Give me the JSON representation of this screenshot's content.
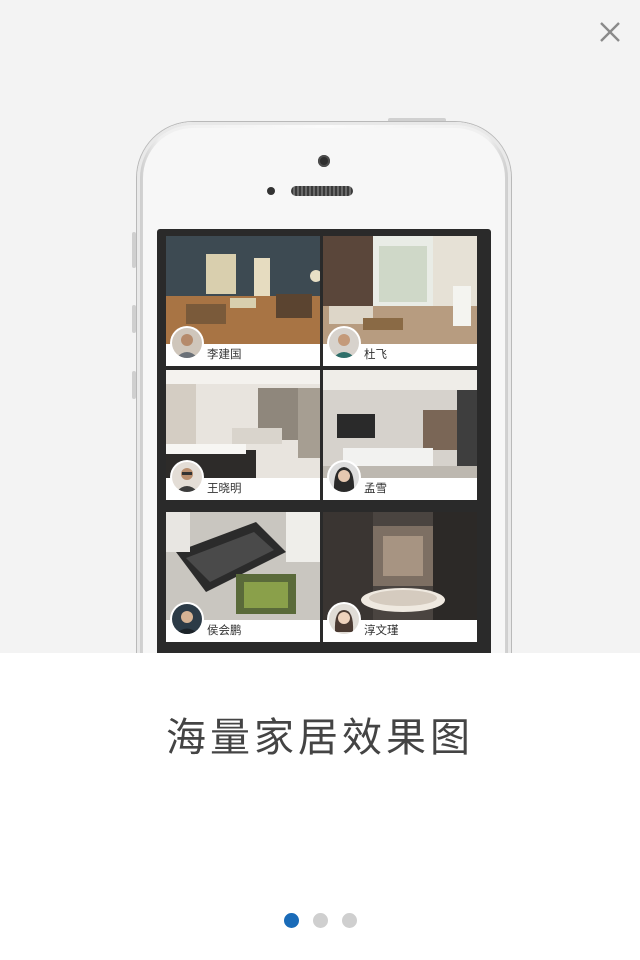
{
  "close": {
    "icon": "close-icon"
  },
  "feature": {
    "headline": "海量家居效果图"
  },
  "designers": [
    {
      "name": "李建国"
    },
    {
      "name": "杜飞"
    },
    {
      "name": "王晓明"
    },
    {
      "name": "孟雪"
    },
    {
      "name": "侯会鹏"
    },
    {
      "name": "淳文瑾"
    }
  ],
  "pagination": {
    "total": 3,
    "active_index": 0
  },
  "colors": {
    "accent": "#1a6bb8",
    "inactive_dot": "#cfcfcf",
    "background": "#f3f3f3"
  }
}
